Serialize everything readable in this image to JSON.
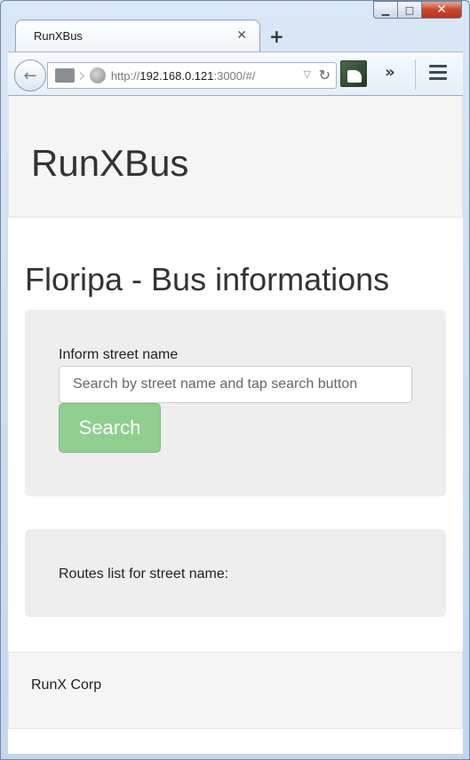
{
  "browser": {
    "tab_title": "RunXBus",
    "tab_close": "✕",
    "new_tab": "+",
    "url_prefix": "http://",
    "url_host": "192.168.0.121",
    "url_path": ":3000/#/",
    "window_controls": {
      "minimize": "▁",
      "maximize": "□",
      "close": "✕"
    },
    "overflow": "»"
  },
  "app": {
    "brand": "RunXBus",
    "page_title": "Floripa - Bus informations",
    "search": {
      "label": "Inform street name",
      "placeholder": "Search by street name and tap search button",
      "value": "",
      "button_label": "Search"
    },
    "routes": {
      "label": "Routes list for street name:"
    },
    "footer": "RunX Corp"
  },
  "colors": {
    "search_button": "#8fcf90",
    "panel": "#eeeeee",
    "header": "#f5f5f5"
  }
}
